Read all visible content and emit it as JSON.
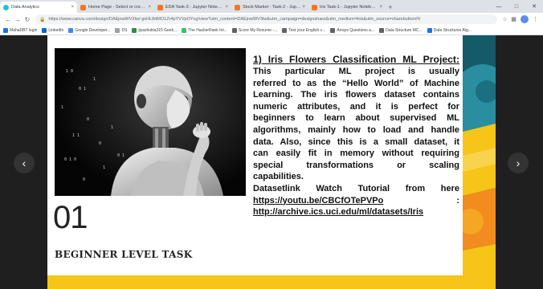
{
  "tabs": [
    {
      "title": "Data Analytics",
      "favicon_color": "#20c4cb",
      "active": true
    },
    {
      "title": "Home Page - Select or create a...",
      "favicon_color": "#f37626",
      "active": false
    },
    {
      "title": "EDA Task-3 - Jupyter Notebook",
      "favicon_color": "#f37626",
      "active": false
    },
    {
      "title": "Stock Market - Task-2 - Jupyter N...",
      "favicon_color": "#f37626",
      "active": false
    },
    {
      "title": "Iris Task-1 - Jupyter Notebook",
      "favicon_color": "#f37626",
      "active": false
    }
  ],
  "browser": {
    "url": "https://www.canva.com/design/DAEjnwWV3Iw/-gsHL8dMO1Zr4pYVVpOYcg/view?utm_content=DAEjnwWV3Iw&utm_campaign=designshare&utm_medium=link&utm_source=sharebutton#9",
    "new_tab_glyph": "+",
    "close_glyph": "×"
  },
  "bookmarks": [
    {
      "label": "MahaDBT login",
      "color": "#1a73e8"
    },
    {
      "label": "LinkedIn",
      "color": "#0a66c2"
    },
    {
      "label": "Google Developer...",
      "color": "#4285f4"
    },
    {
      "label": "DS",
      "color": "#9aa0a6"
    },
    {
      "label": "jiyashukla315 Geek...",
      "color": "#2f8d46"
    },
    {
      "label": "The HackerRank Int...",
      "color": "#2ec866"
    },
    {
      "label": "Score My Resume -...",
      "color": "#5f6368"
    },
    {
      "label": "Test your English c...",
      "color": "#5f6368"
    },
    {
      "label": "Arrays Questions a...",
      "color": "#5f6368"
    },
    {
      "label": "Data Structure MC...",
      "color": "#5f6368"
    },
    {
      "label": "Data Structures Alg...",
      "color": "#1a73e8"
    }
  ],
  "slide": {
    "number": "01",
    "level": "BEGINNER LEVEL TASK",
    "title": "1) Iris Flowers Classification ML Project:",
    "lines": [
      "This particular ML project is usually",
      "referred to as the “Hello World” of Machine",
      "Learning. The iris flowers dataset contains",
      "numeric attributes, and it is perfect for",
      "beginners to learn about supervised ML",
      "algorithms, mainly how to load and handle",
      "data. Also, since this is a small dataset, it",
      "can easily fit in memory without requiring",
      "special transformations or scaling"
    ],
    "last_line": "capabilities.",
    "dataset_line": "Datasetlink Watch Tutorial from here",
    "youtube_link": "https://youtu.be/CBCfOTePVPo",
    "colon": ":",
    "dataset_link": "http://archive.ics.uci.edu/ml/datasets/Iris"
  },
  "nav": {
    "prev": "‹",
    "next": "›"
  },
  "colors": {
    "accent_yellow": "#f7c518",
    "accent_teal": "#1c6f80",
    "accent_orange": "#f28c1e"
  }
}
